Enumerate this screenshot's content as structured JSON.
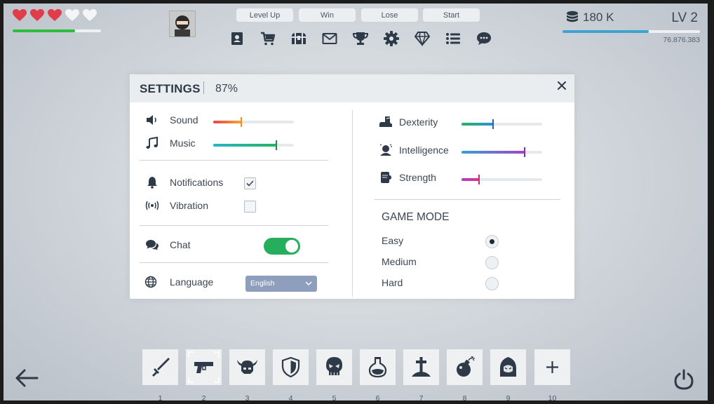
{
  "hud": {
    "hearts": [
      {
        "state": "full"
      },
      {
        "state": "full"
      },
      {
        "state": "full"
      },
      {
        "state": "empty"
      },
      {
        "state": "empty"
      }
    ],
    "health_fraction": 0.71,
    "debug_buttons": [
      "Level Up",
      "Win",
      "Lose",
      "Start"
    ],
    "toolbar_icons": [
      "contacts-icon",
      "shop-cart-icon",
      "treasure-chest-icon",
      "mail-icon",
      "trophy-icon",
      "gear-icon",
      "diamond-icon",
      "list-icon",
      "chat-bubble-icon"
    ],
    "coins": "180 K",
    "level": "LV 2",
    "xp_fraction": 0.63,
    "xp_text": "76.876.383"
  },
  "settings": {
    "title": "SETTINGS",
    "percent": "87%",
    "sound": {
      "label": "Sound",
      "value": 0.35
    },
    "music": {
      "label": "Music",
      "value": 0.78
    },
    "notifications": {
      "label": "Notifications",
      "checked": true
    },
    "vibration": {
      "label": "Vibration",
      "checked": false
    },
    "chat": {
      "label": "Chat",
      "on": true
    },
    "language": {
      "label": "Language",
      "selected": "English"
    },
    "dexterity": {
      "label": "Dexterity",
      "value": 0.39
    },
    "intelligence": {
      "label": "Intelligence",
      "value": 0.78
    },
    "strength": {
      "label": "Strength",
      "value": 0.22
    },
    "game_mode": {
      "title": "GAME MODE",
      "options": [
        {
          "label": "Easy",
          "selected": true
        },
        {
          "label": "Medium",
          "selected": false
        },
        {
          "label": "Hard",
          "selected": false
        }
      ]
    }
  },
  "inventory": {
    "slots": [
      {
        "num": "1",
        "icon": "sword-icon"
      },
      {
        "num": "2",
        "icon": "gun-icon"
      },
      {
        "num": "3",
        "icon": "horned-helmet-icon"
      },
      {
        "num": "4",
        "icon": "shield-icon"
      },
      {
        "num": "5",
        "icon": "skull-icon"
      },
      {
        "num": "6",
        "icon": "potion-icon"
      },
      {
        "num": "7",
        "icon": "grave-icon"
      },
      {
        "num": "8",
        "icon": "bomb-icon"
      },
      {
        "num": "9",
        "icon": "hood-icon"
      },
      {
        "num": "10",
        "icon": "plus-icon"
      }
    ],
    "selected_slot": "2"
  }
}
